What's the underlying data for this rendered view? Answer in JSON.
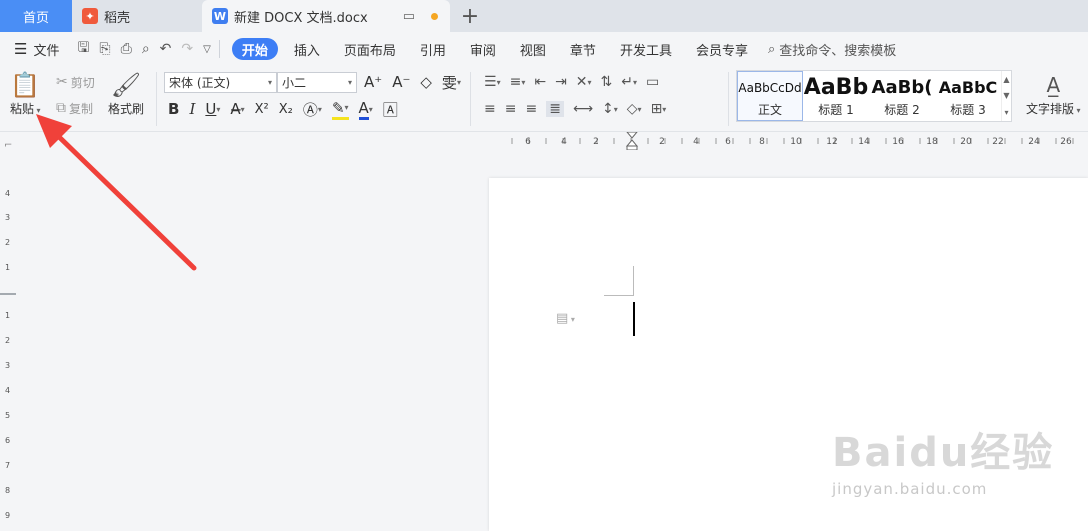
{
  "tabs": {
    "home": "首页",
    "daoke": "稻壳",
    "doc": "新建 DOCX 文档.docx",
    "new_tab": "+"
  },
  "menu": {
    "file_icon": "hamburger-icon",
    "file": "文件",
    "items": [
      "开始",
      "插入",
      "页面布局",
      "引用",
      "审阅",
      "视图",
      "章节",
      "开发工具",
      "会员专享"
    ],
    "active": "开始",
    "search": "查找命令、搜索模板"
  },
  "ribbon": {
    "paste": "粘贴",
    "cut": "剪切",
    "copy": "复制",
    "format_painter": "格式刷",
    "font_name": "宋体 (正文)",
    "font_size": "小二",
    "bold": "B",
    "italic": "I",
    "underline": "U",
    "font_color_a": "A",
    "superscript": "X²",
    "subscript": "X₂",
    "text_layout": "文字排版",
    "styles": [
      {
        "sample": "AaBbCcDd",
        "name": "正文"
      },
      {
        "sample": "AaBb",
        "name": "标题 1"
      },
      {
        "sample": "AaBb(",
        "name": "标题 2"
      },
      {
        "sample": "AaBbC",
        "name": "标题 3"
      }
    ]
  },
  "ruler": {
    "horizontal": [
      "6",
      "4",
      "2",
      "2",
      "4",
      "6",
      "8",
      "10",
      "12",
      "14",
      "16",
      "18",
      "20",
      "22",
      "24",
      "26"
    ],
    "vertical": [
      "4",
      "3",
      "2",
      "1",
      "1",
      "2",
      "3",
      "4",
      "5",
      "6",
      "7",
      "8",
      "9"
    ]
  },
  "watermark": {
    "main": "Baidu经验",
    "sub": "jingyan.baidu.com"
  },
  "colors": {
    "accent": "#3d7ef5",
    "home_tab": "#4a8ef5",
    "arrow": "#f0413a"
  }
}
